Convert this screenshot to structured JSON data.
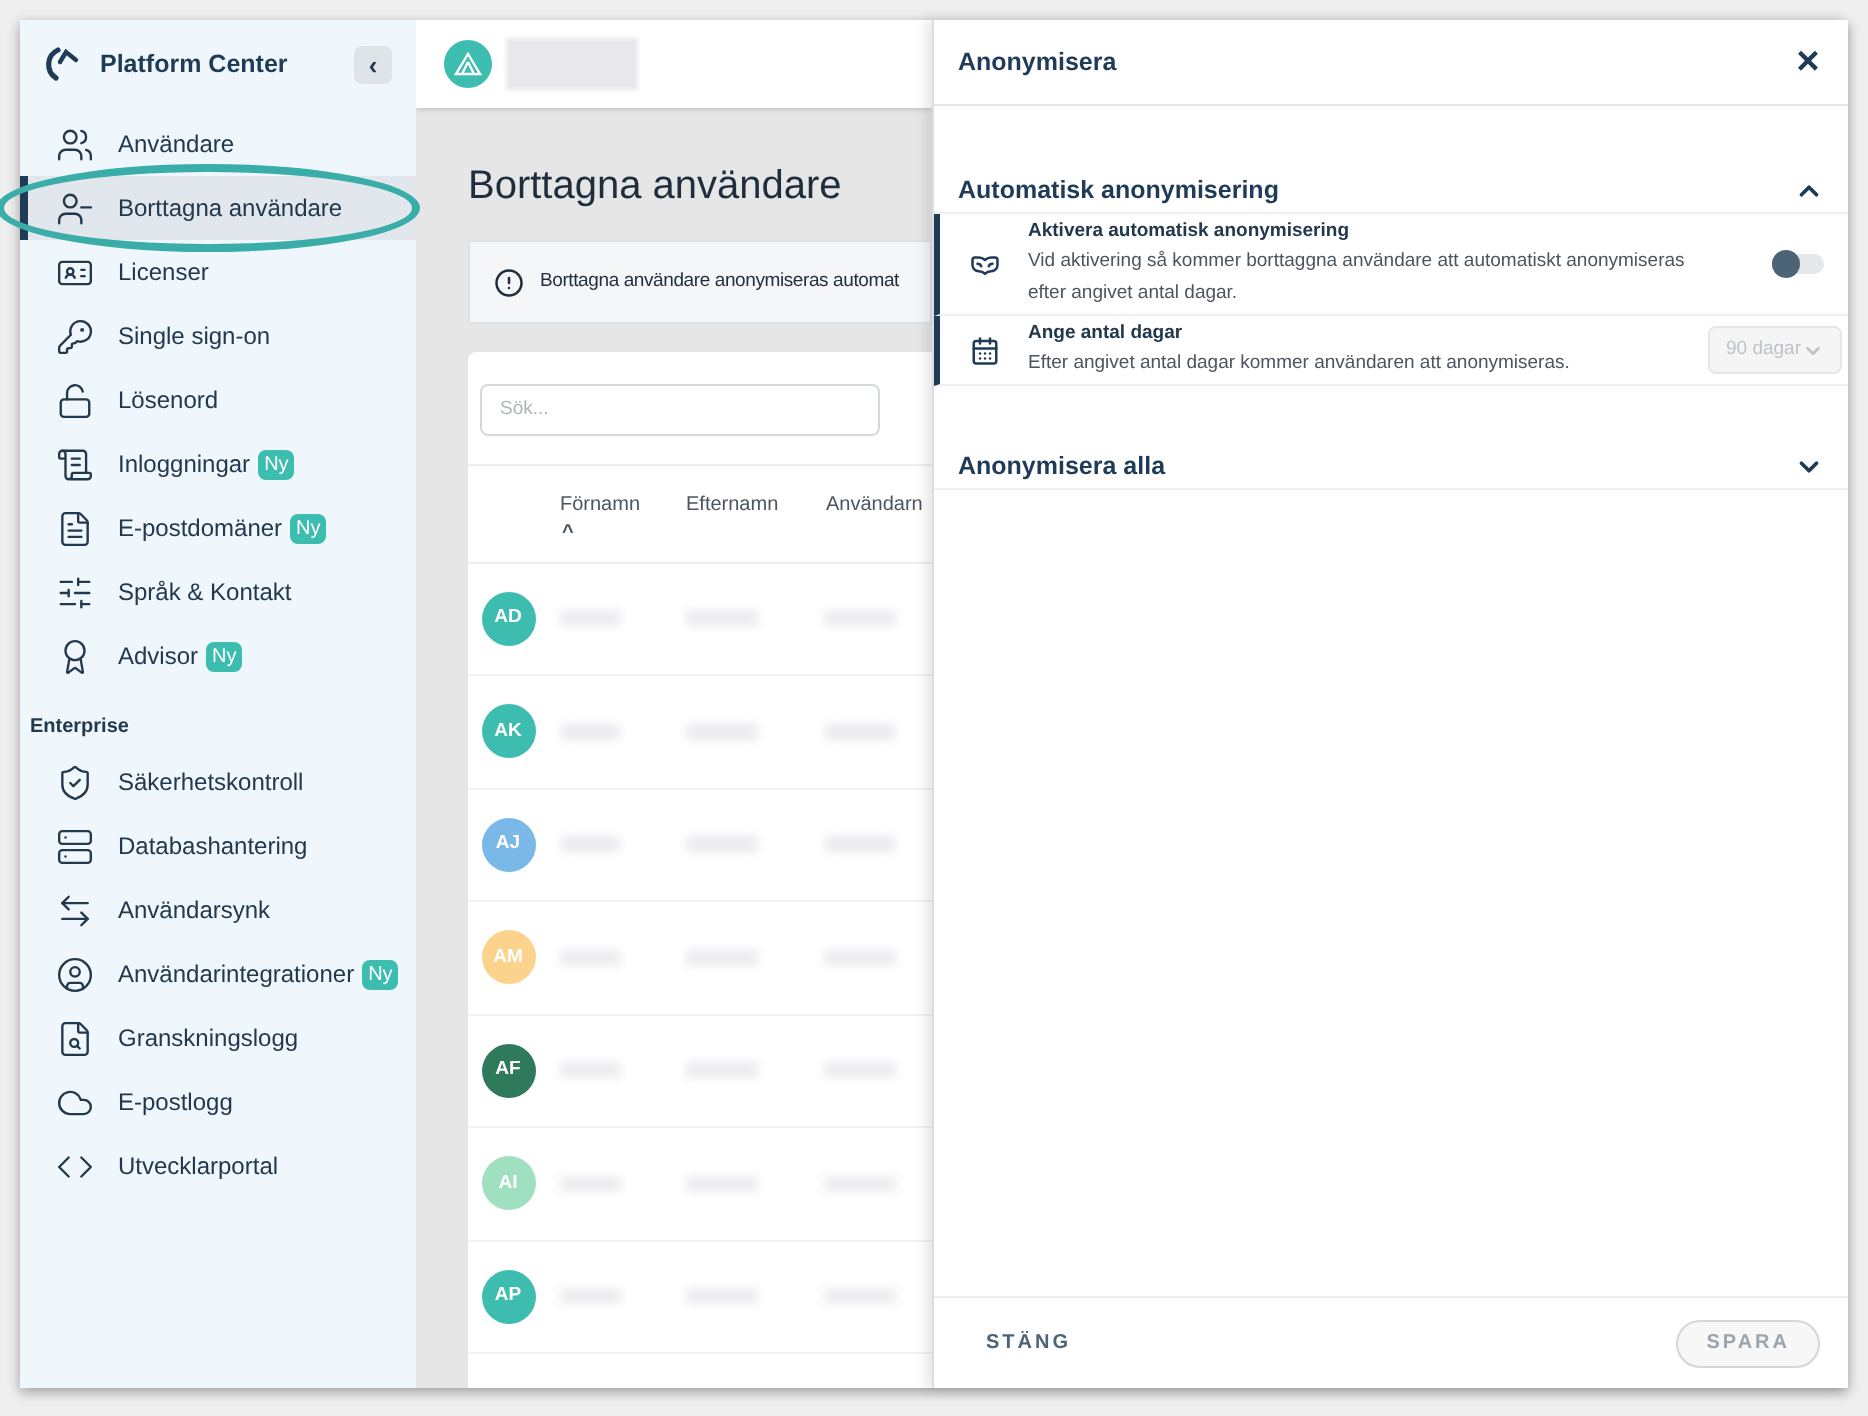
{
  "sidebar": {
    "title": "Platform Center",
    "collapse_button": "‹",
    "items": [
      {
        "label": "Användare",
        "selected": false
      },
      {
        "label": "Borttagna användare",
        "selected": true
      },
      {
        "label": "Licenser",
        "selected": false
      },
      {
        "label": "Single sign-on",
        "selected": false
      },
      {
        "label": "Lösenord",
        "selected": false
      },
      {
        "label": "Inloggningar",
        "selected": false,
        "badge": "Ny"
      },
      {
        "label": "E-postdomäner",
        "selected": false,
        "badge": "Ny"
      },
      {
        "label": "Språk & Kontakt",
        "selected": false
      },
      {
        "label": "Advisor",
        "selected": false,
        "badge": "Ny"
      }
    ],
    "section_title": "Enterprise",
    "enterprise_items": [
      {
        "label": "Säkerhetskontroll",
        "selected": false
      },
      {
        "label": "Databashantering",
        "selected": false
      },
      {
        "label": "Användarsynk",
        "selected": false
      },
      {
        "label": "Användarintegrationer",
        "selected": false,
        "badge": "Ny"
      },
      {
        "label": "Granskningslogg",
        "selected": false
      },
      {
        "label": "E-postlogg",
        "selected": false
      },
      {
        "label": "Utvecklarportal",
        "selected": false
      }
    ]
  },
  "page": {
    "title": "Borttagna användare",
    "info": "Borttagna användare anonymiseras automat",
    "search": {
      "placeholder": "Sök..."
    },
    "columns": [
      "Förnamn",
      "Efternamn",
      "Användarn"
    ],
    "sort_indicator": "^",
    "rows": [
      {
        "initials": "AD",
        "color": "#3dbdb0"
      },
      {
        "initials": "AK",
        "color": "#3dbdb0"
      },
      {
        "initials": "AJ",
        "color": "#7ab8e8"
      },
      {
        "initials": "AM",
        "color": "#fbd38d"
      },
      {
        "initials": "AF",
        "color": "#2f7a5a"
      },
      {
        "initials": "AI",
        "color": "#9ee0bf"
      },
      {
        "initials": "AP",
        "color": "#3dbdb0"
      }
    ]
  },
  "drawer": {
    "title": "Anonymisera",
    "close": "×",
    "sections": [
      {
        "title": "Automatisk anonymisering",
        "expanded": true,
        "items": [
          {
            "kind": "toggle",
            "title": "Aktivera automatisk anonymisering",
            "description": "Vid aktivering så kommer borttaggna användare att automatiskt anonymiseras efter angivet antal dagar.",
            "on": false
          },
          {
            "kind": "select",
            "title": "Ange antal dagar",
            "description": "Efter angivet antal dagar kommer användaren att anonymiseras.",
            "value": "90 dagar",
            "disabled": true
          }
        ]
      },
      {
        "title": "Anonymisera alla",
        "expanded": false
      }
    ],
    "footer": {
      "close_button": "STÄNG",
      "save_button": {
        "label": "SPARA",
        "disabled": true
      }
    }
  }
}
